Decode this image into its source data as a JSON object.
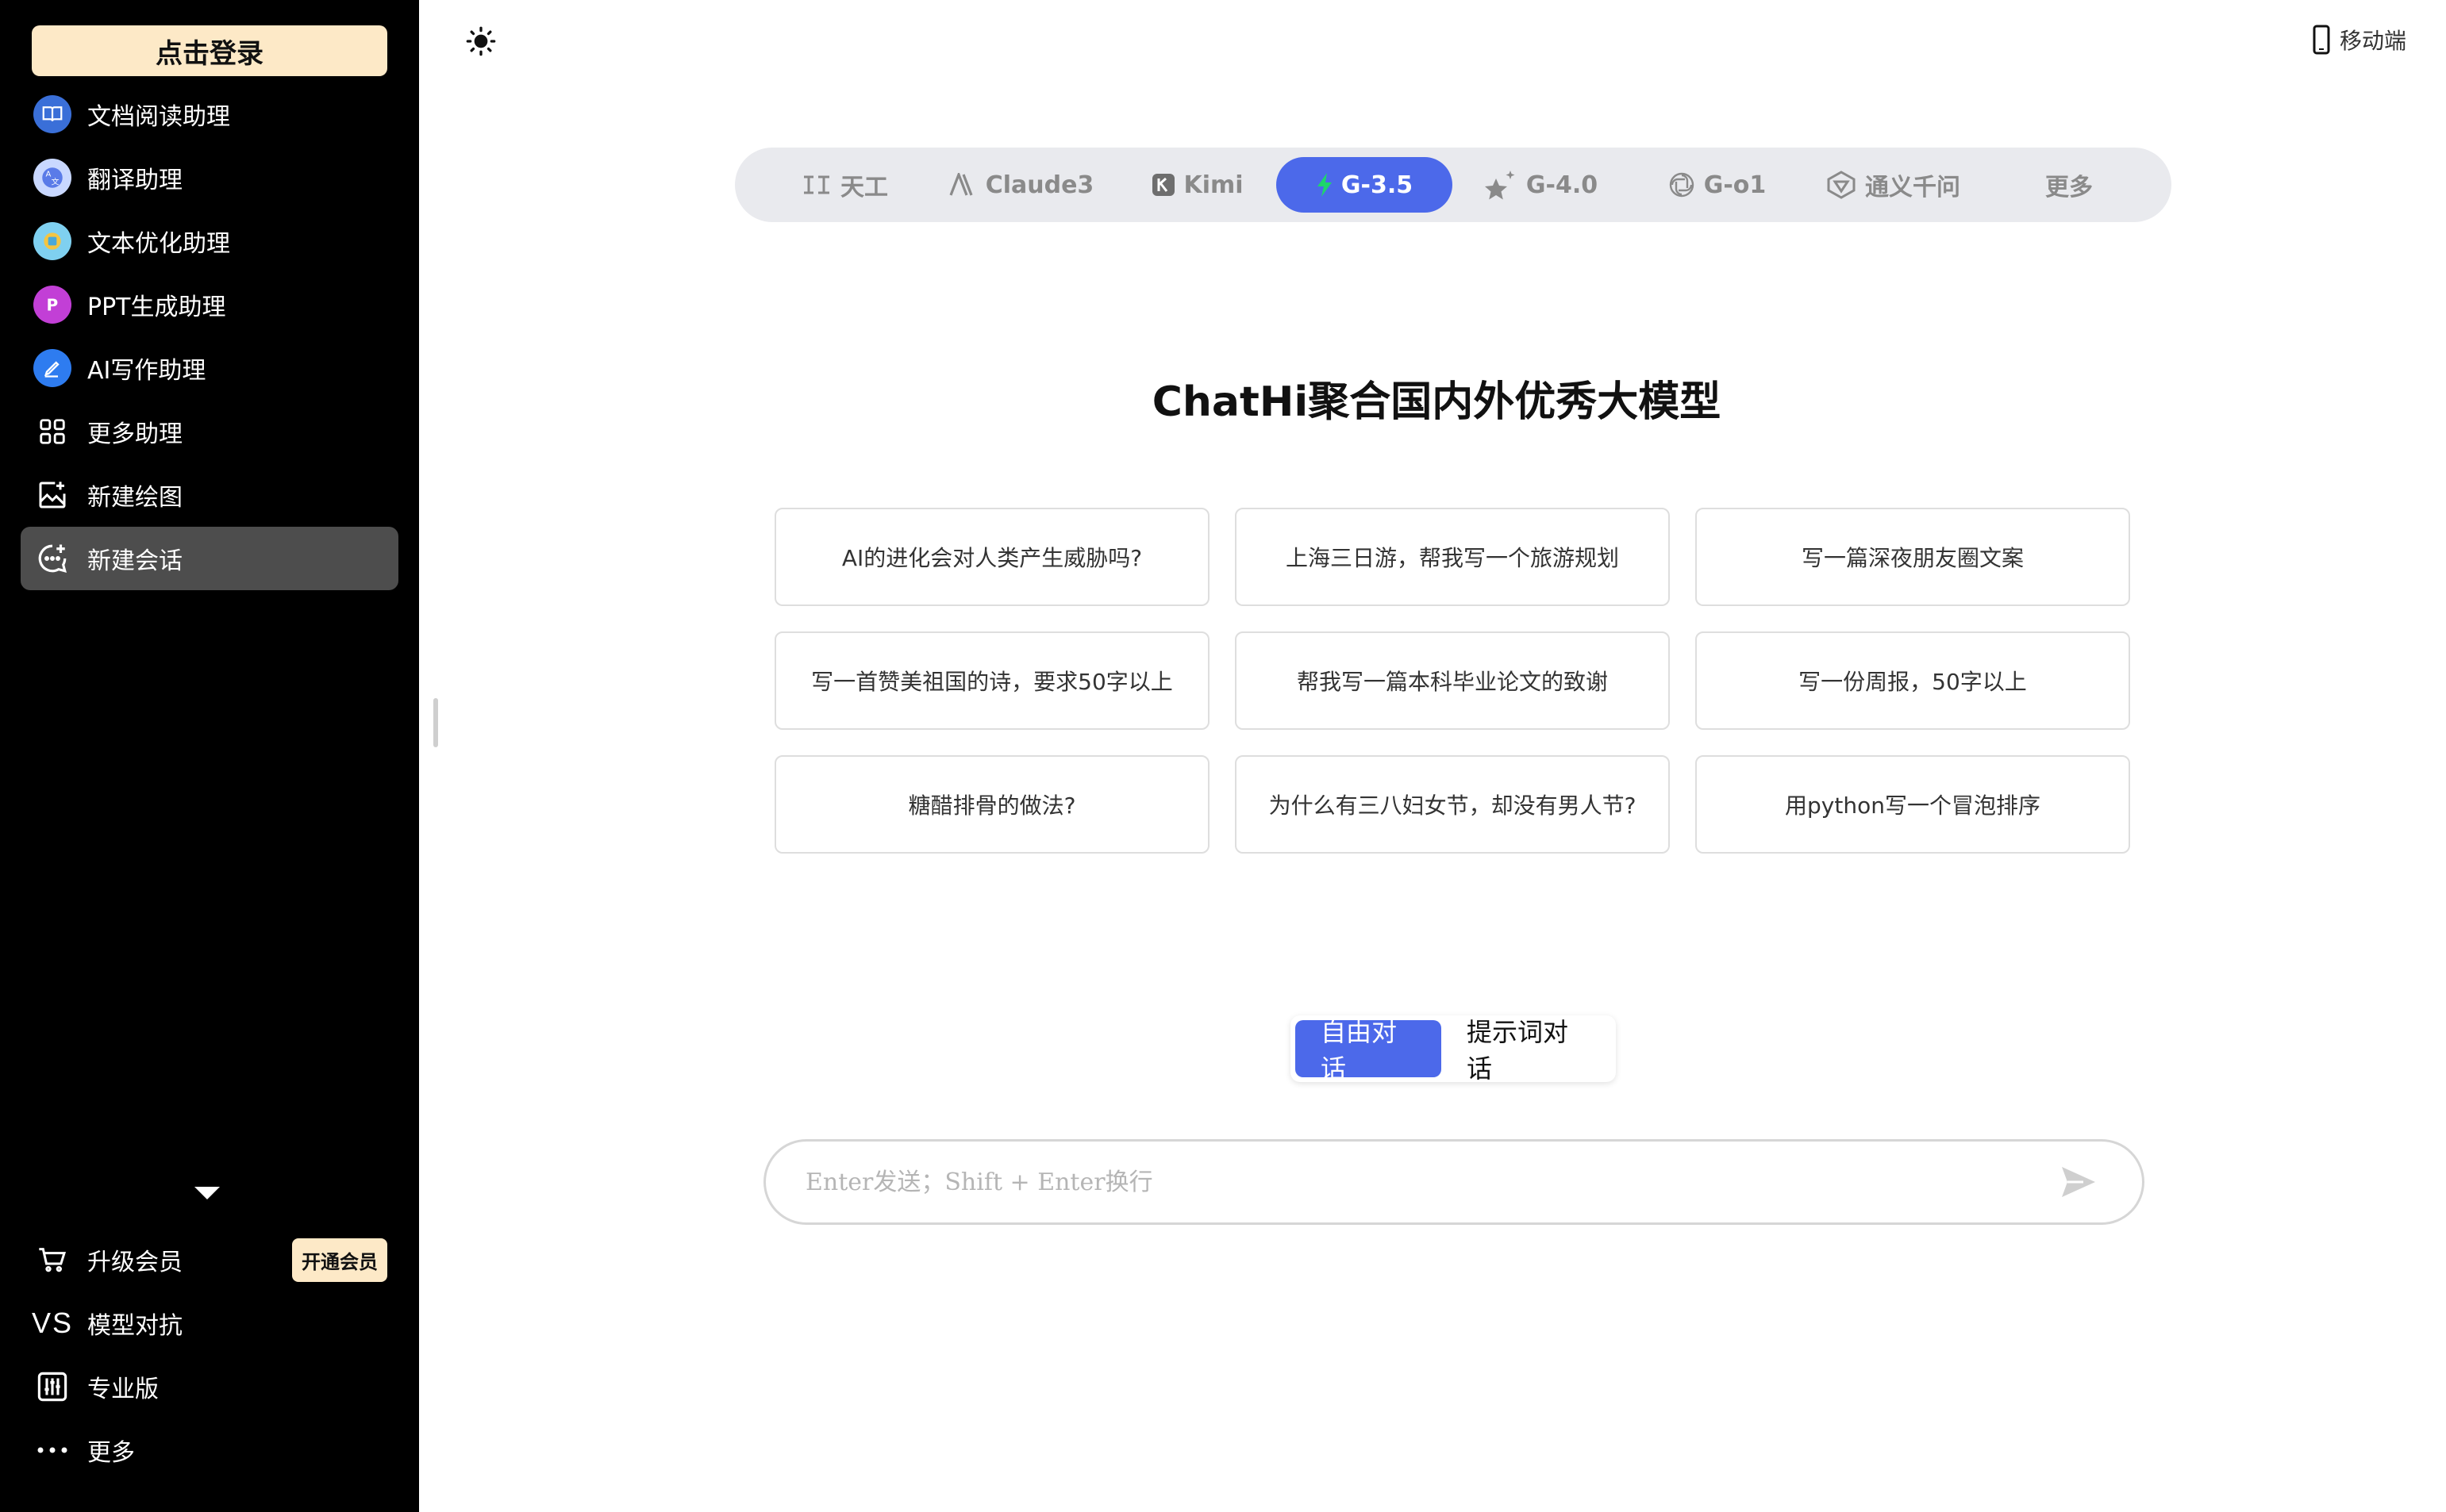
{
  "sidebar": {
    "login_label": "点击登录",
    "items": [
      {
        "label": "文档阅读助理",
        "icon": "book-icon"
      },
      {
        "label": "翻译助理",
        "icon": "translate-icon"
      },
      {
        "label": "文本优化助理",
        "icon": "text-optimize-icon"
      },
      {
        "label": "PPT生成助理",
        "icon": "ppt-icon"
      },
      {
        "label": "AI写作助理",
        "icon": "pen-icon"
      },
      {
        "label": "更多助理",
        "icon": "grid-icon"
      },
      {
        "label": "新建绘图",
        "icon": "image-add-icon"
      },
      {
        "label": "新建会话",
        "icon": "chat-add-icon"
      }
    ],
    "bottom": {
      "upgrade_label": "升级会员",
      "upgrade_badge": "开通会员",
      "vs_icon_text": "VS",
      "vs_label": "模型对抗",
      "pro_label": "专业版",
      "more_label": "更多"
    }
  },
  "header": {
    "mobile_label": "移动端"
  },
  "model_tabs": [
    {
      "label": "天工",
      "icon": "tiangong-icon"
    },
    {
      "label": "Claude3",
      "icon": "anthropic-icon"
    },
    {
      "label": "Kimi",
      "icon": "kimi-icon"
    },
    {
      "label": "G-3.5",
      "icon": "bolt-icon",
      "active": true
    },
    {
      "label": "G-4.0",
      "icon": "sparkle-star-icon"
    },
    {
      "label": "G-o1",
      "icon": "openai-icon"
    },
    {
      "label": "通义千问",
      "icon": "tongyi-icon"
    },
    {
      "label": "更多",
      "icon": ""
    }
  ],
  "main": {
    "heading": "ChatHi聚合国内外优秀大模型",
    "suggestions": [
      "AI的进化会对人类产生威胁吗?",
      "上海三日游，帮我写一个旅游规划",
      "写一篇深夜朋友圈文案",
      "写一首赞美祖国的诗，要求50字以上",
      "帮我写一篇本科毕业论文的致谢",
      "写一份周报，50字以上",
      "糖醋排骨的做法?",
      "为什么有三八妇女节，却没有男人节?",
      "用python写一个冒泡排序"
    ],
    "modes": {
      "free": "自由对话",
      "prompt": "提示词对话"
    },
    "input_placeholder": "Enter发送；Shift + Enter换行"
  },
  "colors": {
    "accent": "#4c69ea",
    "sidebar_bg": "#000000",
    "login_bg": "#fde9c7"
  }
}
